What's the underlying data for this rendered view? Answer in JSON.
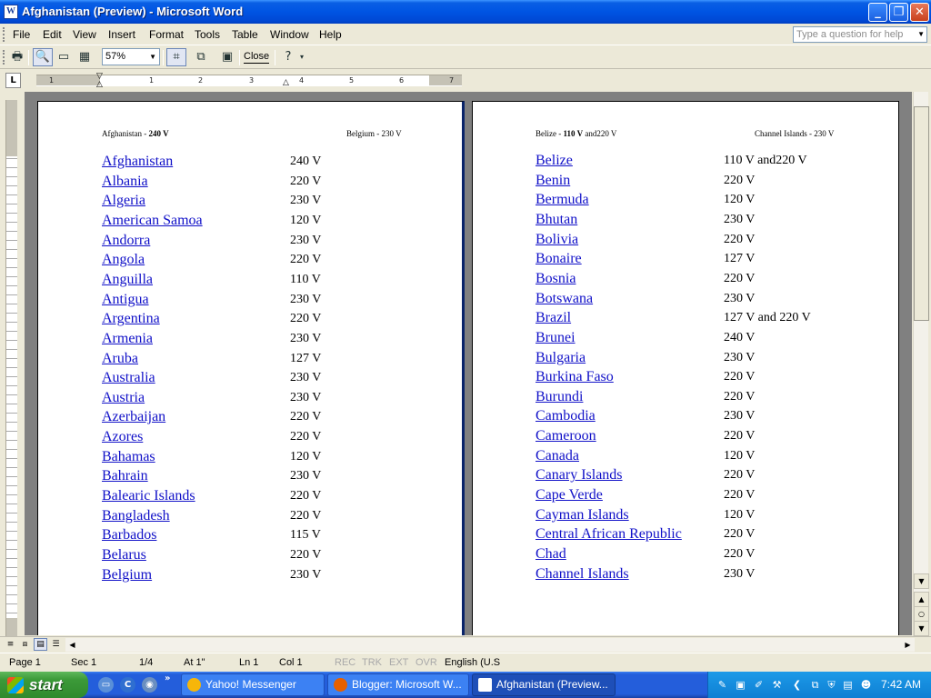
{
  "window": {
    "title": "Afghanistan (Preview) - Microsoft Word",
    "app_icon": "W"
  },
  "menu": {
    "items": [
      "File",
      "Edit",
      "View",
      "Insert",
      "Format",
      "Tools",
      "Table",
      "Window",
      "Help"
    ],
    "ask_placeholder": "Type a question for help"
  },
  "toolbar": {
    "zoom": "57%",
    "close_label": "Close"
  },
  "ruler": {
    "numbers": [
      "1",
      "1",
      "2",
      "3",
      "4",
      "5",
      "6",
      "7"
    ]
  },
  "pages": [
    {
      "header_left": {
        "name": "Afghanistan - ",
        "bold": "240 V",
        "rest": ""
      },
      "header_right": "Belgium - 230 V",
      "rows": [
        {
          "country": "Afghanistan",
          "voltage": "240 V"
        },
        {
          "country": "Albania",
          "voltage": "220 V"
        },
        {
          "country": "Algeria",
          "voltage": "230 V"
        },
        {
          "country": "American Samoa",
          "voltage": "120 V"
        },
        {
          "country": "Andorra",
          "voltage": "230 V"
        },
        {
          "country": "Angola",
          "voltage": "220 V"
        },
        {
          "country": "Anguilla",
          "voltage": "110 V"
        },
        {
          "country": "Antigua",
          "voltage": "230 V"
        },
        {
          "country": "Argentina",
          "voltage": "220 V"
        },
        {
          "country": "Armenia",
          "voltage": "230 V"
        },
        {
          "country": "Aruba",
          "voltage": "127 V"
        },
        {
          "country": "Australia",
          "voltage": "230 V"
        },
        {
          "country": "Austria",
          "voltage": "230 V"
        },
        {
          "country": "Azerbaijan",
          "voltage": "220 V"
        },
        {
          "country": "Azores",
          "voltage": "220 V"
        },
        {
          "country": "Bahamas",
          "voltage": "120 V"
        },
        {
          "country": "Bahrain",
          "voltage": "230 V"
        },
        {
          "country": "Balearic Islands",
          "voltage": "220 V"
        },
        {
          "country": "Bangladesh",
          "voltage": "220 V"
        },
        {
          "country": "Barbados",
          "voltage": "115 V"
        },
        {
          "country": "Belarus",
          "voltage": "220 V"
        },
        {
          "country": "Belgium",
          "voltage": "230 V"
        }
      ]
    },
    {
      "header_left": {
        "name": "Belize - ",
        "bold": "110 V",
        "rest": " and220 V"
      },
      "header_right": "Channel Islands - 230 V",
      "rows": [
        {
          "country": "Belize",
          "voltage": "110 V and220 V"
        },
        {
          "country": "Benin",
          "voltage": "220 V"
        },
        {
          "country": "Bermuda",
          "voltage": "120 V"
        },
        {
          "country": "Bhutan",
          "voltage": "230 V"
        },
        {
          "country": "Bolivia",
          "voltage": "220 V"
        },
        {
          "country": "Bonaire",
          "voltage": "127 V"
        },
        {
          "country": "Bosnia",
          "voltage": "220 V"
        },
        {
          "country": "Botswana",
          "voltage": "230 V"
        },
        {
          "country": "Brazil",
          "voltage": "127 V and 220 V"
        },
        {
          "country": "Brunei",
          "voltage": "240 V"
        },
        {
          "country": "Bulgaria",
          "voltage": "230 V"
        },
        {
          "country": "Burkina Faso",
          "voltage": "220 V"
        },
        {
          "country": "Burundi",
          "voltage": "220 V"
        },
        {
          "country": "Cambodia",
          "voltage": "230 V"
        },
        {
          "country": "Cameroon",
          "voltage": "220 V"
        },
        {
          "country": "Canada",
          "voltage": "120 V"
        },
        {
          "country": "Canary Islands",
          "voltage": "220 V"
        },
        {
          "country": "Cape Verde",
          "voltage": "220 V"
        },
        {
          "country": "Cayman Islands",
          "voltage": "120 V"
        },
        {
          "country": "Central African Republic",
          "voltage": "220 V"
        },
        {
          "country": "Chad",
          "voltage": "220 V"
        },
        {
          "country": "Channel Islands",
          "voltage": "230 V"
        }
      ]
    }
  ],
  "status": {
    "page": "Page  1",
    "sec": "Sec  1",
    "pages": "1/4",
    "at": "At  1\"",
    "ln": "Ln  1",
    "col": "Col  1",
    "rec": "REC",
    "trk": "TRK",
    "ext": "EXT",
    "ovr": "OVR",
    "language": "English (U.S"
  },
  "taskbar": {
    "start": "start",
    "tasks": [
      {
        "label": "Yahoo! Messenger",
        "icon": "yahoo-messenger-icon",
        "color": "#f6b60a"
      },
      {
        "label": "Blogger: Microsoft W...",
        "icon": "firefox-icon",
        "color": "#e66000"
      },
      {
        "label": "Afghanistan (Preview...",
        "icon": "word-icon",
        "color": "#ffffff"
      }
    ],
    "clock": "7:42 AM"
  },
  "colors": {
    "link": "#1010c8",
    "titlebar": "#0054e3",
    "taskbar": "#245edb",
    "start_green": "#3c9a39"
  }
}
